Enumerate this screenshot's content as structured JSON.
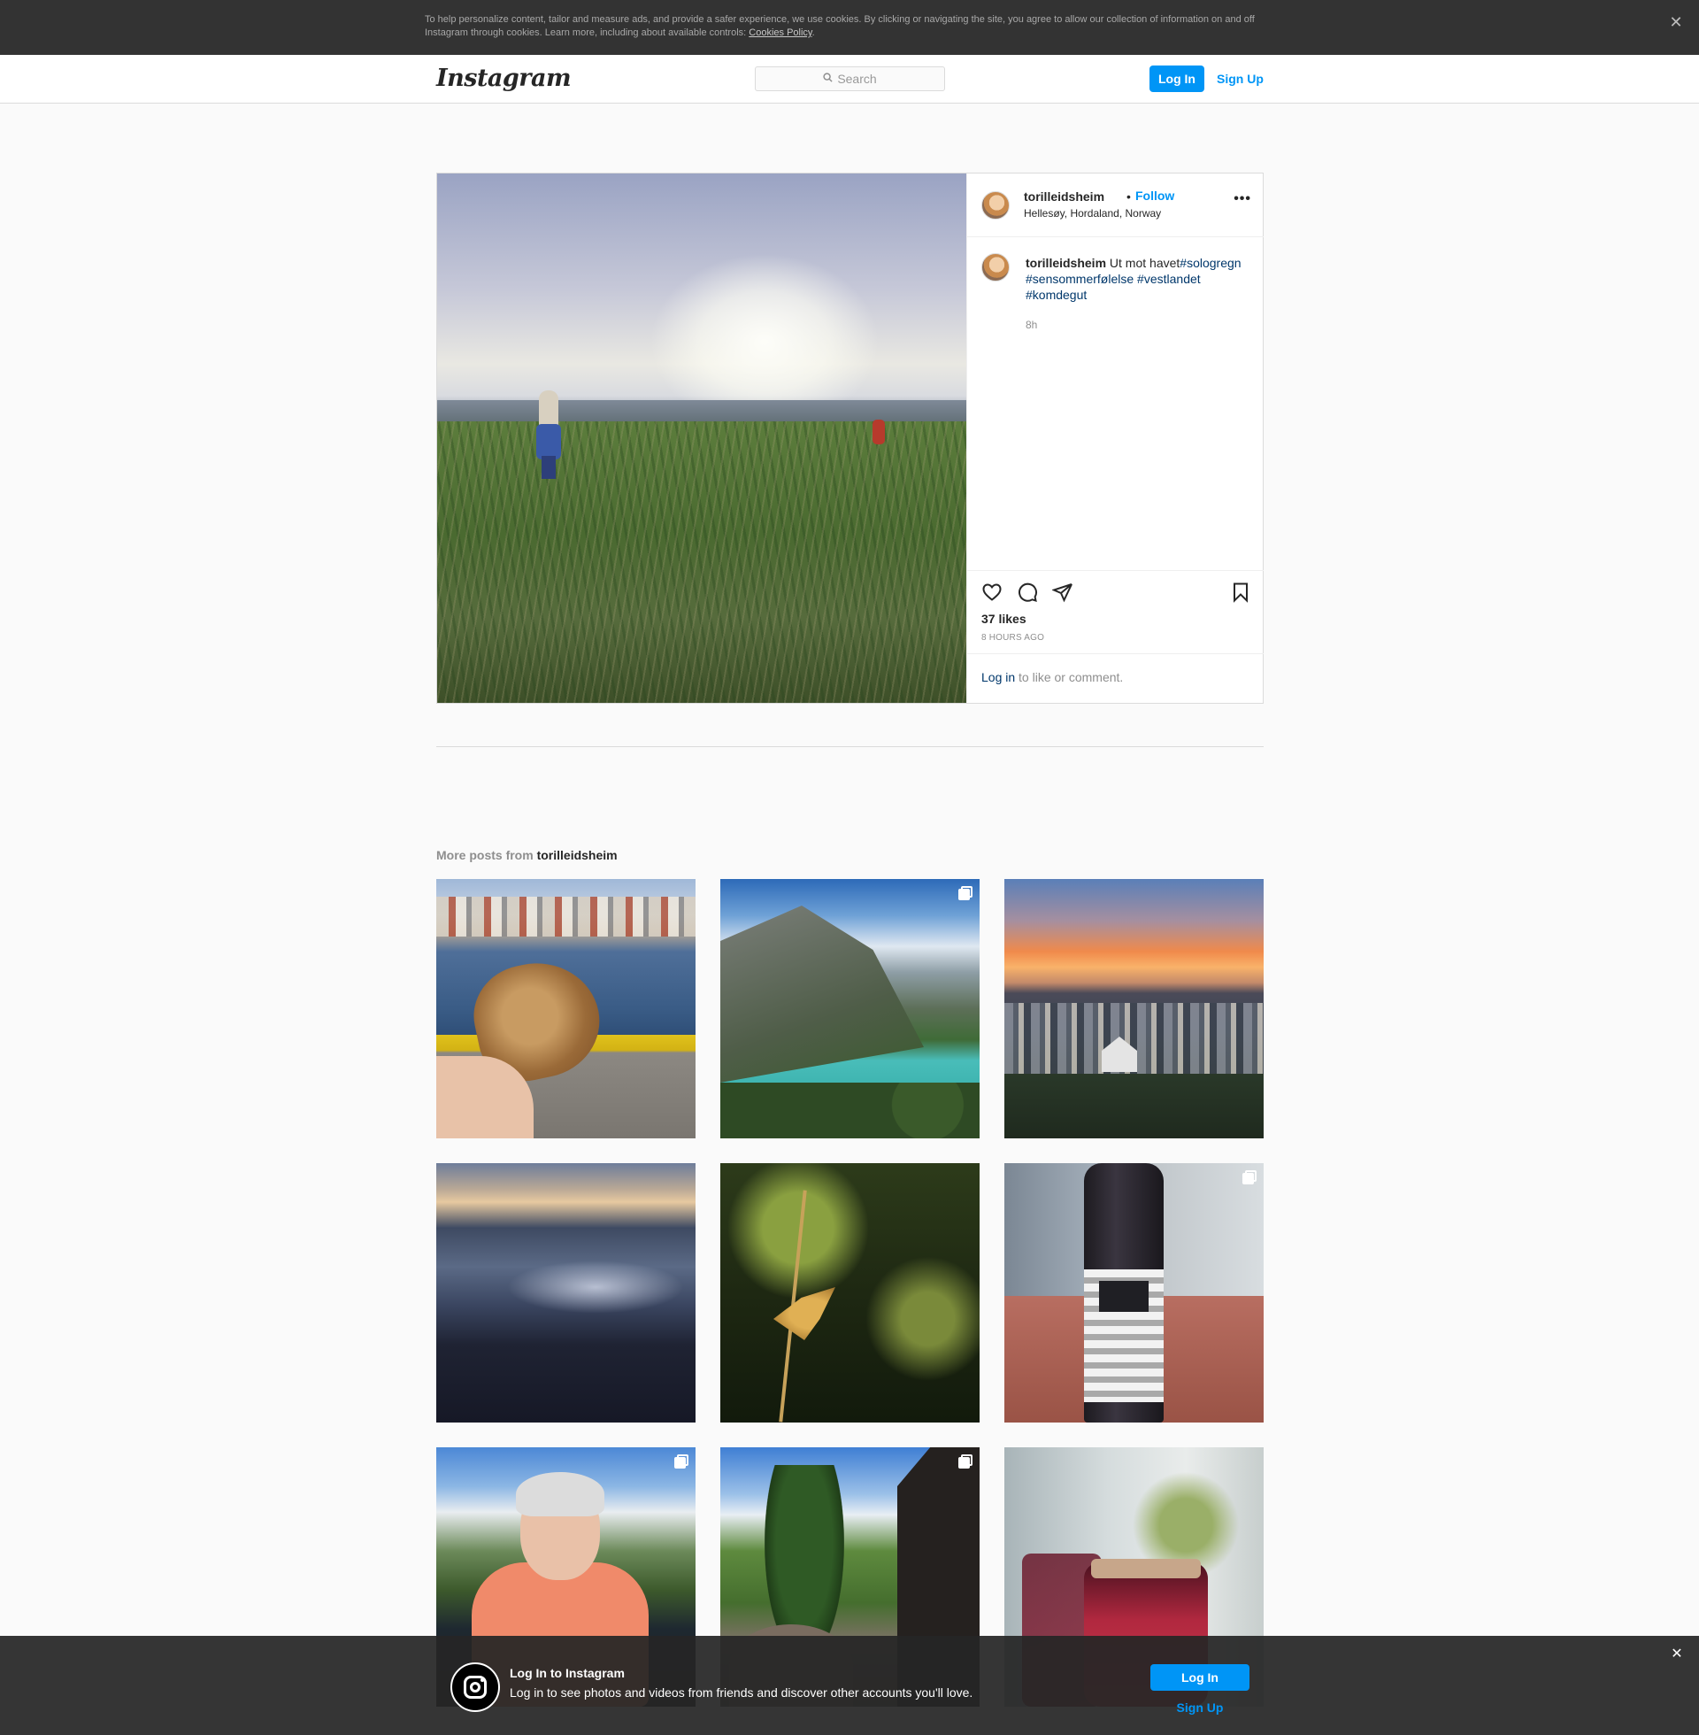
{
  "cookie_banner": {
    "text": "To help personalize content, tailor and measure ads, and provide a safer experience, we use cookies. By clicking or navigating the site, you agree to allow our collection of information on and off Instagram through cookies. Learn more, including about available controls: ",
    "link": "Cookies Policy",
    "period": ".",
    "close": "✕"
  },
  "header": {
    "logo": "Instagram",
    "search_placeholder": "Search",
    "search_icon": "🔍",
    "login_label": "Log In",
    "signup_label": "Sign Up"
  },
  "post": {
    "owner": "torilleidsheim",
    "follow_separator": "•",
    "follow_label": "Follow",
    "location": "Hellesøy, Hordaland, Norway",
    "more": "•••",
    "caption_author": "torilleidsheim",
    "caption_text": "Ut mot havet",
    "caption_tags": [
      "#sologregn",
      "#sensommerfølelse",
      "#vestlandet",
      "#komdegut"
    ],
    "caption_time": "8h",
    "likes": "37 likes",
    "time_ago": "8 HOURS AGO",
    "login_link": "Log in",
    "login_rest": " to like or comment."
  },
  "more_posts": {
    "prefix": "More posts from ",
    "owner": "torilleidsheim"
  },
  "bottom_bar": {
    "title": "Log In to Instagram",
    "subtitle": "Log in to see photos and videos from friends and discover other accounts you'll love.",
    "login_label": "Log In",
    "signup_label": "Sign Up",
    "close": "✕"
  },
  "colors": {
    "accent": "#0095f6",
    "link_dark": "#00376b",
    "cookie_bg": "#333333",
    "bottom_bar_bg": "#262626"
  }
}
